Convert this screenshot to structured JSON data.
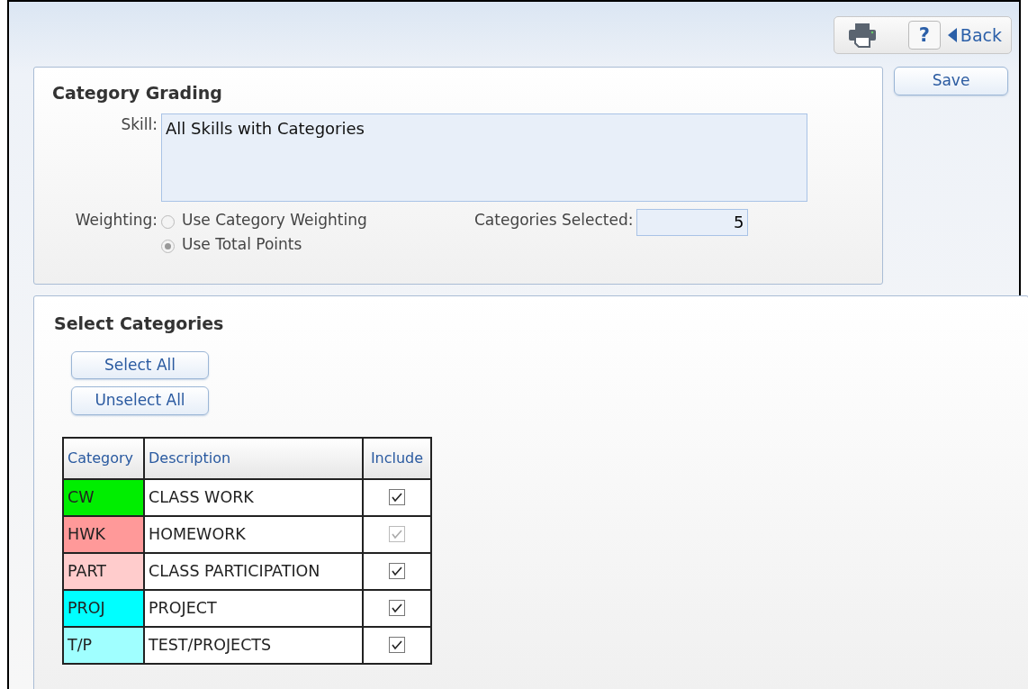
{
  "toolbar": {
    "help_label": "?",
    "back_label": "Back"
  },
  "save_button": "Save",
  "grading": {
    "title": "Category Grading",
    "skill_label": "Skill:",
    "skill_value": "All Skills with Categories",
    "weighting_label": "Weighting:",
    "weighting_options": [
      {
        "label": "Use Category Weighting",
        "selected": false
      },
      {
        "label": "Use Total Points",
        "selected": true
      }
    ],
    "selected_label": "Categories Selected:",
    "selected_value": "5"
  },
  "categories": {
    "title": "Select Categories",
    "select_all": "Select All",
    "unselect_all": "Unselect All",
    "columns": [
      "Category",
      "Description",
      "Include"
    ],
    "rows": [
      {
        "code": "CW",
        "color": "#00ee00",
        "description": "CLASS WORK",
        "included": true,
        "disabled": false
      },
      {
        "code": "HWK",
        "color": "#ff9999",
        "description": "HOMEWORK",
        "included": true,
        "disabled": true
      },
      {
        "code": "PART",
        "color": "#ffcccc",
        "description": "CLASS PARTICIPATION",
        "included": true,
        "disabled": false
      },
      {
        "code": "PROJ",
        "color": "#00ffff",
        "description": "PROJECT",
        "included": true,
        "disabled": false
      },
      {
        "code": "T/P",
        "color": "#a0ffff",
        "description": "TEST/PROJECTS",
        "included": true,
        "disabled": false
      }
    ]
  }
}
